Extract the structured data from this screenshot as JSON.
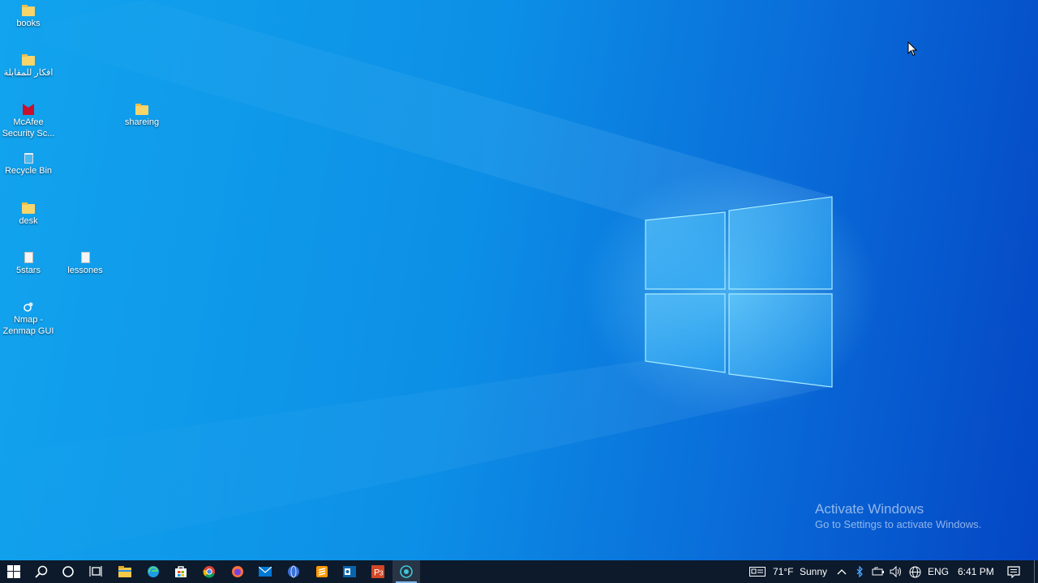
{
  "desktop": {
    "icons": [
      {
        "label": "books"
      },
      {
        "label": "افكار للمقابلة"
      },
      {
        "label": "McAfee Security Sc..."
      },
      {
        "label": "shareing"
      },
      {
        "label": "Recycle Bin"
      },
      {
        "label": "desk"
      },
      {
        "label": "5stars"
      },
      {
        "label": "lessones"
      },
      {
        "label": "Nmap - Zenmap GUI"
      }
    ],
    "watermark": {
      "title": "Activate Windows",
      "subtitle": "Go to Settings to activate Windows."
    }
  },
  "taskbar": {
    "apps": [
      {
        "icon": "start-icon"
      },
      {
        "icon": "search-icon"
      },
      {
        "icon": "cortana-icon"
      },
      {
        "icon": "task-view-icon"
      },
      {
        "icon": "file-explorer-icon"
      },
      {
        "icon": "edge-icon"
      },
      {
        "icon": "store-icon"
      },
      {
        "icon": "chrome-icon"
      },
      {
        "icon": "firefox-icon"
      },
      {
        "icon": "mail-icon"
      },
      {
        "icon": "browser-icon"
      },
      {
        "icon": "sublime-icon"
      },
      {
        "icon": "outlook-icon"
      },
      {
        "icon": "powerpoint-icon"
      },
      {
        "icon": "screen-recorder-icon"
      }
    ],
    "tray": {
      "temperature": "71°F",
      "weather": "Sunny",
      "language": "ENG",
      "time": "6:41 PM"
    }
  },
  "colors": {
    "taskbar_bg": "#0c1a2c",
    "accent": "#7db7f0",
    "folder": "#f7d56b"
  }
}
